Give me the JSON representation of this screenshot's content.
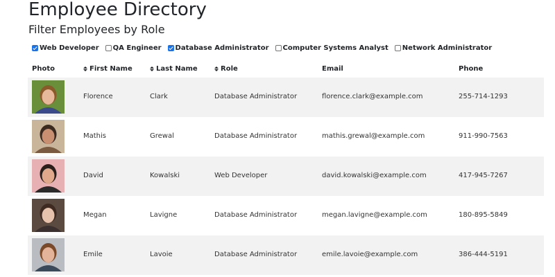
{
  "page": {
    "title": "Employee Directory",
    "subtitle": "Filter Employees by Role"
  },
  "filters": [
    {
      "label": "Web Developer",
      "checked": true
    },
    {
      "label": "QA Engineer",
      "checked": false
    },
    {
      "label": "Database Administrator",
      "checked": true
    },
    {
      "label": "Computer Systems Analyst",
      "checked": false
    },
    {
      "label": "Network Administrator",
      "checked": false
    }
  ],
  "table": {
    "headers": {
      "photo": "Photo",
      "first_name": "First Name",
      "last_name": "Last Name",
      "role": "Role",
      "email": "Email",
      "phone": "Phone"
    },
    "rows": [
      {
        "first_name": "Florence",
        "last_name": "Clark",
        "role": "Database Administrator",
        "email": "florence.clark@example.com",
        "phone": "255-714-1293",
        "photo": {
          "bg": "#6a8f3a",
          "skin": "#e8b89a",
          "hair": "#8a5a2b",
          "shirt": "#3b4a8a"
        }
      },
      {
        "first_name": "Mathis",
        "last_name": "Grewal",
        "role": "Database Administrator",
        "email": "mathis.grewal@example.com",
        "phone": "911-990-7563",
        "photo": {
          "bg": "#c9b59a",
          "skin": "#c89070",
          "hair": "#3a2a20",
          "shirt": "#7a5a40"
        }
      },
      {
        "first_name": "David",
        "last_name": "Kowalski",
        "role": "Web Developer",
        "email": "david.kowalski@example.com",
        "phone": "417-945-7267",
        "photo": {
          "bg": "#e7b0b2",
          "skin": "#e0a98c",
          "hair": "#2a1f1a",
          "shirt": "#2a2a2a"
        }
      },
      {
        "first_name": "Megan",
        "last_name": "Lavigne",
        "role": "Database Administrator",
        "email": "megan.lavigne@example.com",
        "phone": "180-895-5849",
        "photo": {
          "bg": "#5a4a40",
          "skin": "#e6c2ac",
          "hair": "#3e2a20",
          "shirt": "#3a3030"
        }
      },
      {
        "first_name": "Emile",
        "last_name": "Lavoie",
        "role": "Database Administrator",
        "email": "emile.lavoie@example.com",
        "phone": "386-444-5191",
        "photo": {
          "bg": "#b9bcc0",
          "skin": "#e4b49a",
          "hair": "#7a4a2a",
          "shirt": "#3a4a5a"
        }
      }
    ]
  }
}
